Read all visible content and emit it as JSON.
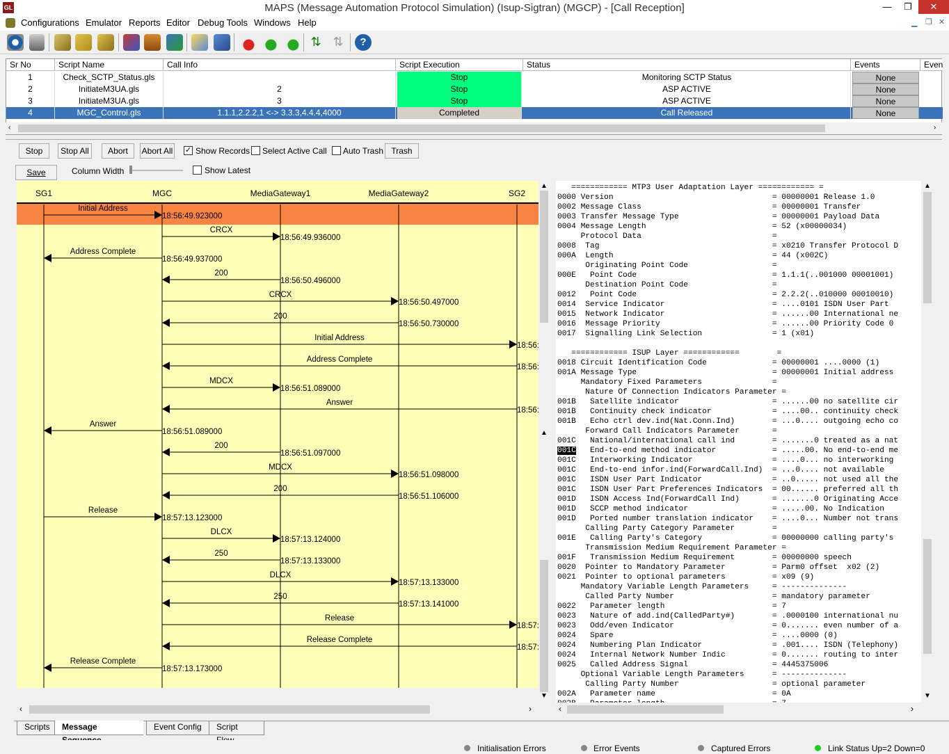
{
  "window": {
    "title": "MAPS (Message Automation Protocol Simulation) (Isup-Sigtran) (MGCP)  - [Call Reception]",
    "logo": "GL"
  },
  "menu": [
    "Configurations",
    "Emulator",
    "Reports",
    "Editor",
    "Debug Tools",
    "Windows",
    "Help"
  ],
  "grid": {
    "headers": [
      "Sr No",
      "Script Name",
      "Call Info",
      "Script Execution",
      "Status",
      "Events",
      "Even"
    ],
    "rows": [
      {
        "sr": "1",
        "script": "Check_SCTP_Status.gls",
        "info": "",
        "exec": "Stop",
        "status": "Monitoring SCTP Status",
        "events": "None"
      },
      {
        "sr": "2",
        "script": "InitiateM3UA.gls",
        "info": "2",
        "exec": "Stop",
        "status": "ASP ACTIVE",
        "events": "None"
      },
      {
        "sr": "3",
        "script": "InitiateM3UA.gls",
        "info": "3",
        "exec": "Stop",
        "status": "ASP ACTIVE",
        "events": "None"
      },
      {
        "sr": "4",
        "script": "MGC_Control.gls",
        "info": "1.1.1,2.2.2,1 <-> 3.3.3,4.4.4,4000",
        "exec": "Completed",
        "status": "Call Released",
        "events": "None"
      }
    ]
  },
  "controls": {
    "stop": "Stop",
    "stop_all": "Stop All",
    "abort": "Abort",
    "abort_all": "Abort All",
    "show_records": "Show Records",
    "select_active_call": "Select Active Call",
    "auto_trash": "Auto Trash",
    "trash": "Trash",
    "save": "Save",
    "column_width": "Column Width",
    "show_latest": "Show Latest",
    "show_records_checked": true,
    "select_active_checked": false,
    "auto_trash_checked": false,
    "show_latest_checked": false
  },
  "ladder": {
    "entities": [
      "SG1",
      "MGC",
      "MediaGateway1",
      "MediaGateway2",
      "SG2"
    ],
    "messages": [
      {
        "label": "Initial Address",
        "from": 0,
        "to": 1,
        "time": "18:56:49.923000",
        "highlight": true
      },
      {
        "label": "CRCX",
        "from": 1,
        "to": 2,
        "time": "18:56:49.936000"
      },
      {
        "label": "Address Complete",
        "from": 1,
        "to": 0,
        "time": "18:56:49.937000"
      },
      {
        "label": "200",
        "from": 2,
        "to": 1,
        "time": "18:56:50.496000"
      },
      {
        "label": "CRCX",
        "from": 1,
        "to": 3,
        "time": "18:56:50.497000"
      },
      {
        "label": "200",
        "from": 3,
        "to": 1,
        "time": "18:56:50.730000"
      },
      {
        "label": "Initial Address",
        "from": 1,
        "to": 4,
        "time": "18:56:"
      },
      {
        "label": "Address Complete",
        "from": 4,
        "to": 1,
        "time": "18:56:"
      },
      {
        "label": "MDCX",
        "from": 1,
        "to": 2,
        "time": "18:56:51.089000"
      },
      {
        "label": "Answer",
        "from": 4,
        "to": 1,
        "time": "18:56:"
      },
      {
        "label": "Answer",
        "from": 1,
        "to": 0,
        "time": "18:56:51.089000"
      },
      {
        "label": "200",
        "from": 2,
        "to": 1,
        "time": "18:56:51.097000"
      },
      {
        "label": "MDCX",
        "from": 1,
        "to": 3,
        "time": "18:56:51.098000"
      },
      {
        "label": "200",
        "from": 3,
        "to": 1,
        "time": "18:56:51.106000"
      },
      {
        "label": "Release",
        "from": 0,
        "to": 1,
        "time": "18:57:13.123000"
      },
      {
        "label": "DLCX",
        "from": 1,
        "to": 2,
        "time": "18:57:13.124000"
      },
      {
        "label": "250",
        "from": 2,
        "to": 1,
        "time": "18:57:13.133000"
      },
      {
        "label": "DLCX",
        "from": 1,
        "to": 3,
        "time": "18:57:13.133000"
      },
      {
        "label": "250",
        "from": 3,
        "to": 1,
        "time": "18:57:13.141000"
      },
      {
        "label": "Release",
        "from": 1,
        "to": 4,
        "time": "18:57:"
      },
      {
        "label": "Release Complete",
        "from": 4,
        "to": 1,
        "time": "18:57:"
      },
      {
        "label": "Release Complete",
        "from": 1,
        "to": 0,
        "time": "18:57:13.173000"
      }
    ]
  },
  "decode": [
    "   ============ MTP3 User Adaptation Layer ============ =",
    "0000 Version                                  = 00000001 Release 1.0",
    "0002 Message Class                            = 00000001 Transfer",
    "0003 Transfer Message Type                    = 00000001 Payload Data",
    "0004 Message Length                           = 52 (x00000034)",
    "     Protocol Data                            =",
    "0008  Tag                                     = x0210 Transfer Protocol D",
    "000A  Length                                  = 44 (x002C)",
    "      Originating Point Code                  =",
    "000E   Point Code                             = 1.1.1(..001000 00001001)",
    "      Destination Point Code                  =",
    "0012   Point Code                             = 2.2.2(..010000 00010010)",
    "0014  Service Indicator                       = ....0101 ISDN User Part",
    "0015  Network Indicator                       = ......00 International ne",
    "0016  Message Priority                        = ......00 Priority Code 0",
    "0017  Signalling Link Selection               = 1 (x01)",
    "",
    "   ============ ISUP Layer ============        =",
    "0018 Circuit Identification Code              = 00000001 ....0000 (1)",
    "001A Message Type                             = 00000001 Initial address",
    "     Mandatory Fixed Parameters               =",
    "      Nature Of Connection Indicators Parameter =",
    "001B   Satellite indicator                    = ......00 no satellite cir",
    "001B   Continuity check indicator             = ....00.. continuity check",
    "001B   Echo ctrl dev.ind(Nat.Conn.Ind)        = ...0.... outgoing echo co",
    "      Forward Call Indicators Parameter       =",
    "001C   National/international call ind        = .......0 treated as a nat",
    "001C   End-to-end method indicator            = .....00. No end-to-end me",
    "001C   Interworking Indicator                 = ....0... no interworking",
    "001C   End-to-end infor.ind(ForwardCall.Ind)  = ...0.... not available",
    "001C   ISDN User Part Indicator               = ..0..... not used all the",
    "001C   ISDN User Part Preferences Indicators  = 00...... preferred all th",
    "001D   ISDN Access Ind(ForwardCall Ind)       = .......0 Originating Acce",
    "001D   SCCP method indicator                  = .....00. No Indication",
    "001D   Ported number translation indicator    = ....0... Number not trans",
    "      Calling Party Category Parameter        =",
    "001E   Calling Party's Category               = 00000000 calling party's",
    "      Transmission Medium Requirement Parameter =",
    "001F   Transmission Medium Requirement        = 00000000 speech",
    "0020  Pointer to Mandatory Parameter          = Parm0 offset  x02 (2)",
    "0021  Pointer to optional parameters          = x09 (9)",
    "     Mandatory Variable Length Parameters     = --------------",
    "      Called Party Number                     = mandatory parameter",
    "0022   Parameter length                       = 7",
    "0023   Nature of add.ind(CalledParty#)        = .0000100 international nu",
    "0023   Odd/even Indicator                     = 0....... even number of a",
    "0024   Spare                                  = ....0000 (0)",
    "0024   Numbering Plan Indicator               = .001.... ISDN (Telephony)",
    "0024   Internal Network Number Indic          = 0....... routing to inter",
    "0025   Called Address Signal                  = 4445375006",
    "     Optional Variable Length Parameters      = --------------",
    "      Calling Party Number                    = optional parameter",
    "002A   Parameter name                         = 0A",
    "002B   Parameter length                       = 7"
  ],
  "tabs": [
    "Scripts",
    "Message Sequence",
    "Event Config",
    "Script Flow"
  ],
  "active_tab": "Message Sequence",
  "status": {
    "init_errors": "Initialisation Errors",
    "error_events": "Error Events",
    "captured_errors": "Captured Errors",
    "link_status": "Link Status Up=2 Down=0"
  },
  "colors": {
    "stop_green": "#00ff7f",
    "selected_row": "#3b73b9",
    "highlight_row": "#f88444",
    "ladder_bg": "#fffeb8",
    "link_green": "#22cc22"
  }
}
